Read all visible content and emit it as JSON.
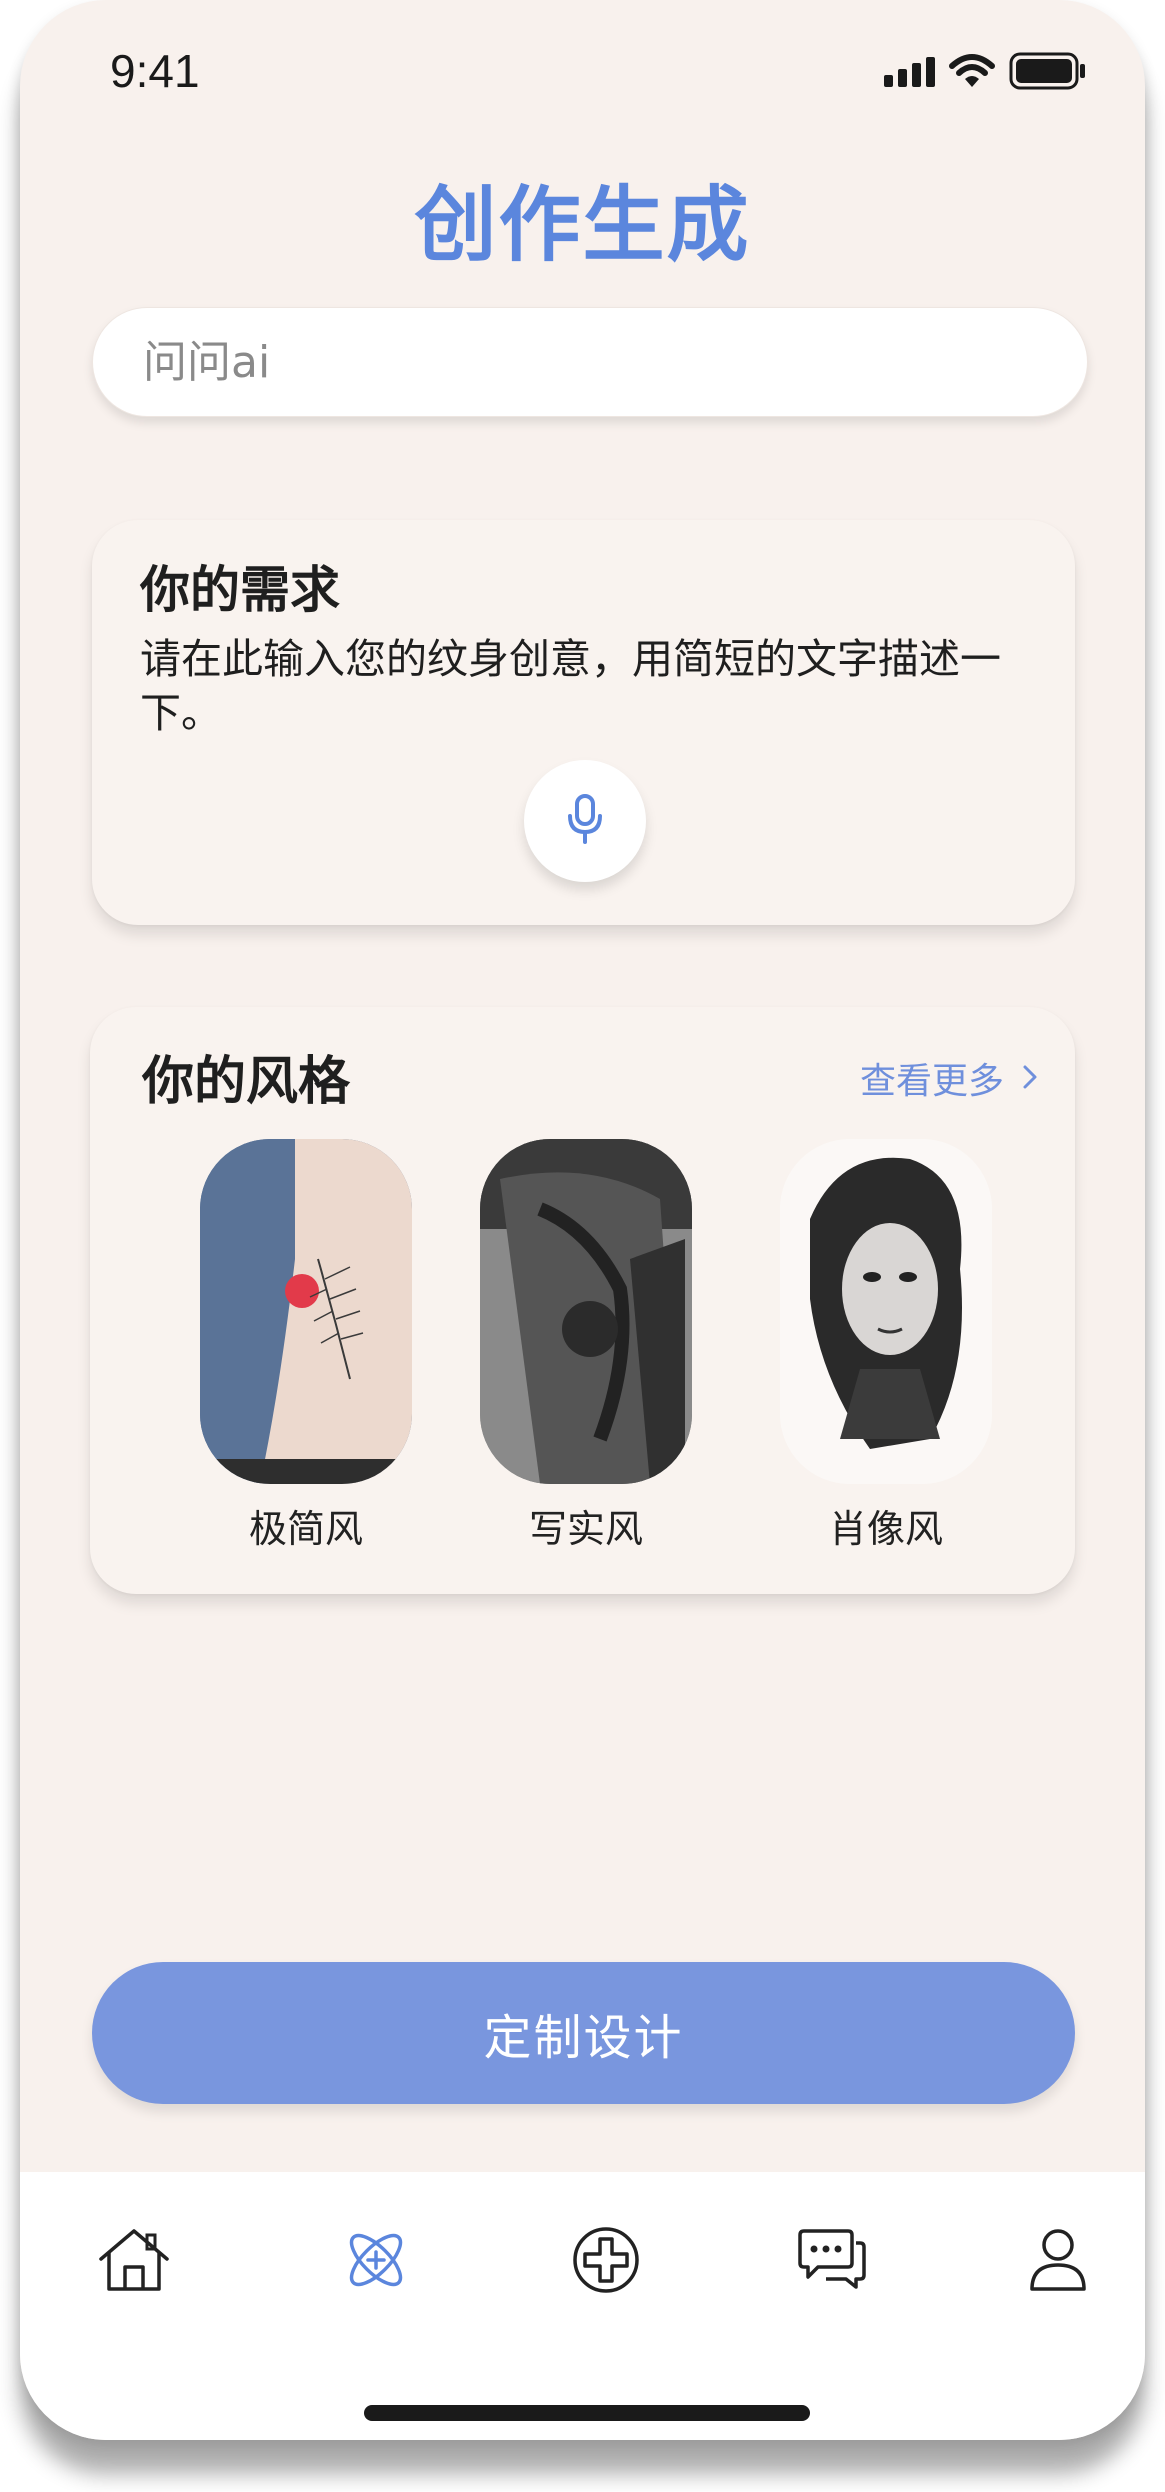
{
  "status_bar": {
    "time": "9:41"
  },
  "header": {
    "title": "创作生成"
  },
  "search": {
    "placeholder": "问问ai"
  },
  "needs_card": {
    "title": "你的需求",
    "description": "请在此输入您的纹身创意，用简短的文字描述一下。",
    "mic_icon": "microphone-icon"
  },
  "style_card": {
    "title": "你的风格",
    "see_more": "查看更多",
    "items": [
      {
        "label": "极简风"
      },
      {
        "label": "写实风"
      },
      {
        "label": "肖像风"
      }
    ]
  },
  "cta": {
    "label": "定制设计"
  },
  "tabbar": {
    "items": [
      {
        "icon": "home-icon"
      },
      {
        "icon": "atom-create-icon",
        "active": true
      },
      {
        "icon": "plus-circle-icon"
      },
      {
        "icon": "chat-icon"
      },
      {
        "icon": "user-icon"
      }
    ]
  },
  "colors": {
    "accent": "#5b86dd",
    "button": "#7996de",
    "background": "#f8f1ed"
  }
}
